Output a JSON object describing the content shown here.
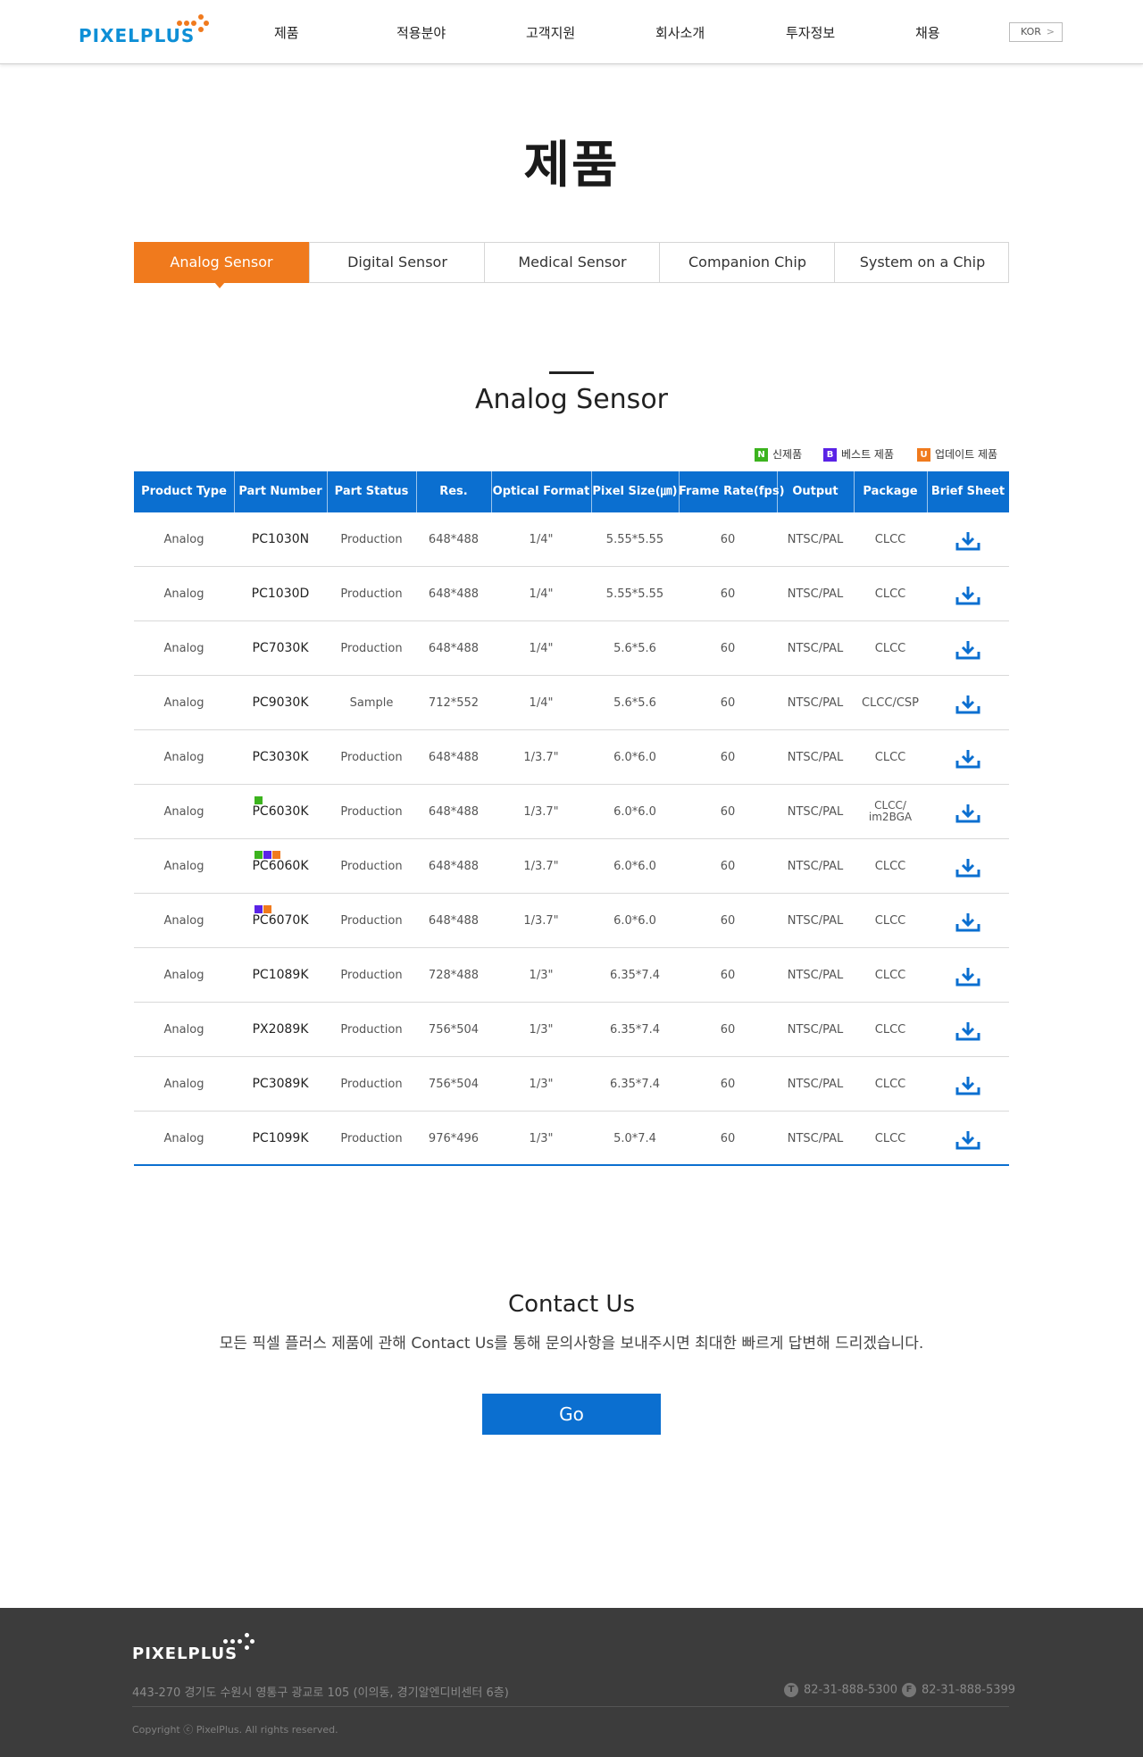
{
  "header": {
    "logo_text": "PIXELPLUS",
    "nav": [
      "제품",
      "적용분야",
      "고객지원",
      "회사소개",
      "투자정보",
      "채용"
    ],
    "lang_label": "KOR",
    "lang_arrow": ">"
  },
  "page_title": "제품",
  "tabs": [
    {
      "label": "Analog Sensor",
      "active": true
    },
    {
      "label": "Digital Sensor",
      "active": false
    },
    {
      "label": "Medical Sensor",
      "active": false
    },
    {
      "label": "Companion Chip",
      "active": false
    },
    {
      "label": "System on a Chip",
      "active": false
    }
  ],
  "section_title": "Analog Sensor",
  "legend": [
    {
      "badge": "N",
      "label": "신제품",
      "color": "#3cb31e"
    },
    {
      "badge": "B",
      "label": "베스트 제품",
      "color": "#5a23e6"
    },
    {
      "badge": "U",
      "label": "업데이트 제품",
      "color": "#f07a1d"
    }
  ],
  "table": {
    "headers": [
      "Product Type",
      "Part Number",
      "Part Status",
      "Res.",
      "Optical Format",
      "Pixel Size(㎛)",
      "Frame Rate(fps)",
      "Output",
      "Package",
      "Brief Sheet"
    ],
    "rows": [
      {
        "type": "Analog",
        "part": "PC1030N",
        "status": "Production",
        "res": "648*488",
        "optical": "1/4\"",
        "pixel": "5.55*5.55",
        "fps": "60",
        "output": "NTSC/PAL",
        "package": "CLCC",
        "package2": "",
        "marks": []
      },
      {
        "type": "Analog",
        "part": "PC1030D",
        "status": "Production",
        "res": "648*488",
        "optical": "1/4\"",
        "pixel": "5.55*5.55",
        "fps": "60",
        "output": "NTSC/PAL",
        "package": "CLCC",
        "package2": "",
        "marks": []
      },
      {
        "type": "Analog",
        "part": "PC7030K",
        "status": "Production",
        "res": "648*488",
        "optical": "1/4\"",
        "pixel": "5.6*5.6",
        "fps": "60",
        "output": "NTSC/PAL",
        "package": "CLCC",
        "package2": "",
        "marks": []
      },
      {
        "type": "Analog",
        "part": "PC9030K",
        "status": "Sample",
        "res": "712*552",
        "optical": "1/4\"",
        "pixel": "5.6*5.6",
        "fps": "60",
        "output": "NTSC/PAL",
        "package": "CLCC/CSP",
        "package2": "",
        "marks": []
      },
      {
        "type": "Analog",
        "part": "PC3030K",
        "status": "Production",
        "res": "648*488",
        "optical": "1/3.7\"",
        "pixel": "6.0*6.0",
        "fps": "60",
        "output": "NTSC/PAL",
        "package": "CLCC",
        "package2": "",
        "marks": []
      },
      {
        "type": "Analog",
        "part": "PC6030K",
        "status": "Production",
        "res": "648*488",
        "optical": "1/3.7\"",
        "pixel": "6.0*6.0",
        "fps": "60",
        "output": "NTSC/PAL",
        "package": "CLCC/",
        "package2": "im2BGA",
        "marks": [
          "#3cb31e"
        ]
      },
      {
        "type": "Analog",
        "part": "PC6060K",
        "status": "Production",
        "res": "648*488",
        "optical": "1/3.7\"",
        "pixel": "6.0*6.0",
        "fps": "60",
        "output": "NTSC/PAL",
        "package": "CLCC",
        "package2": "",
        "marks": [
          "#3cb31e",
          "#5a23e6",
          "#f07a1d"
        ]
      },
      {
        "type": "Analog",
        "part": "PC6070K",
        "status": "Production",
        "res": "648*488",
        "optical": "1/3.7\"",
        "pixel": "6.0*6.0",
        "fps": "60",
        "output": "NTSC/PAL",
        "package": "CLCC",
        "package2": "",
        "marks": [
          "#5a23e6",
          "#f07a1d"
        ]
      },
      {
        "type": "Analog",
        "part": "PC1089K",
        "status": "Production",
        "res": "728*488",
        "optical": "1/3\"",
        "pixel": "6.35*7.4",
        "fps": "60",
        "output": "NTSC/PAL",
        "package": "CLCC",
        "package2": "",
        "marks": []
      },
      {
        "type": "Analog",
        "part": "PX2089K",
        "status": "Production",
        "res": "756*504",
        "optical": "1/3\"",
        "pixel": "6.35*7.4",
        "fps": "60",
        "output": "NTSC/PAL",
        "package": "CLCC",
        "package2": "",
        "marks": []
      },
      {
        "type": "Analog",
        "part": "PC3089K",
        "status": "Production",
        "res": "756*504",
        "optical": "1/3\"",
        "pixel": "6.35*7.4",
        "fps": "60",
        "output": "NTSC/PAL",
        "package": "CLCC",
        "package2": "",
        "marks": []
      },
      {
        "type": "Analog",
        "part": "PC1099K",
        "status": "Production",
        "res": "976*496",
        "optical": "1/3\"",
        "pixel": "5.0*7.4",
        "fps": "60",
        "output": "NTSC/PAL",
        "package": "CLCC",
        "package2": "",
        "marks": []
      }
    ],
    "download_icon": "download-icon",
    "header_color": "#0b6fd0"
  },
  "contact": {
    "title": "Contact Us",
    "desc": "모든 픽셀 플러스 제품에 관해 Contact Us를 통해 문의사항을 보내주시면 최대한 빠르게 답변해 드리겠습니다.",
    "go_label": "Go"
  },
  "footer": {
    "logo_text": "PIXELPLUS",
    "address": "443-270 경기도 수원시 영통구 광교로 105 (이의동, 경기알엔디비센터 6층)",
    "tel_badge": "T",
    "tel": "82-31-888-5300",
    "fax_badge": "F",
    "fax": "82-31-888-5399",
    "copyright": "Copyright ⓒ PixelPlus. All rights reserved."
  },
  "colors": {
    "accent_orange": "#f07a1d",
    "accent_blue": "#0b6fd0",
    "logo_blue": "#0e8fd6",
    "footer_bg": "#3c3c3c"
  }
}
